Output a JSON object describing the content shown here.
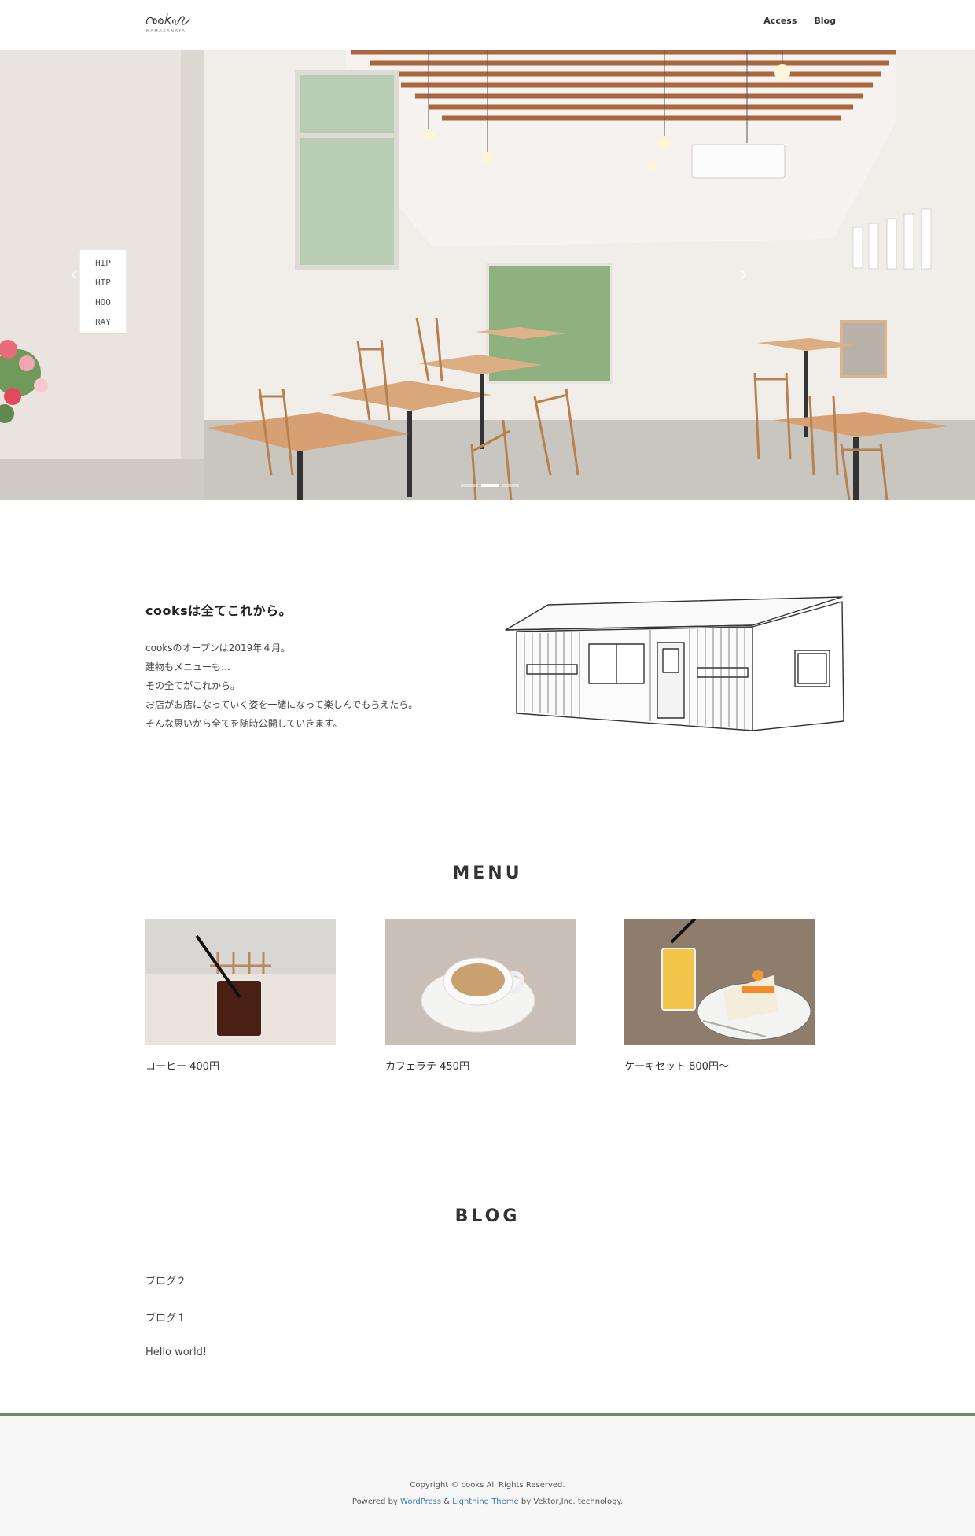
{
  "header": {
    "logo_script": "cooks",
    "logo_sub": "HAMAKANAYA",
    "nav": [
      {
        "label": "Access"
      },
      {
        "label": "Blog"
      }
    ]
  },
  "hero": {
    "poster_lines": [
      "HIP",
      "HIP",
      "HOO",
      "RAY"
    ],
    "prev_glyph": "‹",
    "next_glyph": "›",
    "slides_count": 3,
    "active_slide": 1
  },
  "intro": {
    "title": "cooksは全てこれから。",
    "lines": [
      "cooksのオープンは2019年４月。",
      "建物もメニューも…",
      "その全てがこれから。",
      "お店がお店になっていく姿を一緒になって楽しんでもらえたら。",
      "そんな思いから全てを随時公開していきます。"
    ]
  },
  "menu": {
    "title": "MENU",
    "items": [
      {
        "label": "コーヒー 400円"
      },
      {
        "label": "カフェラテ 450円"
      },
      {
        "label": "ケーキセット 800円〜"
      }
    ]
  },
  "blog": {
    "title": "BLOG",
    "posts": [
      {
        "title": "ブログ２"
      },
      {
        "title": "ブログ１"
      },
      {
        "title": "Hello world!"
      }
    ]
  },
  "footer": {
    "copyright": "Copyright © cooks All Rights Reserved.",
    "powered_prefix": "Powered by",
    "wordpress": "WordPress",
    "amp": "&",
    "lightning": "Lightning Theme",
    "powered_suffix": "by Vektor,Inc. technology."
  },
  "colors": {
    "footer_border": "#6b8e5e",
    "link": "#337ab7",
    "beam": "#a8673f"
  }
}
